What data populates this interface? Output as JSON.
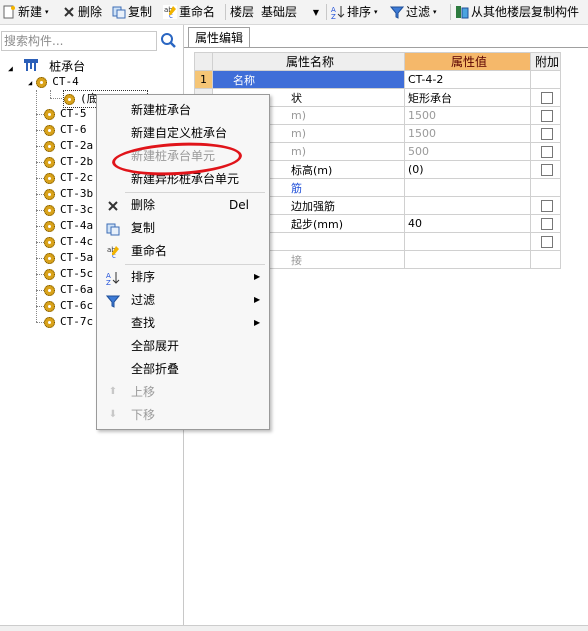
{
  "toolbar": {
    "new_label": "新建",
    "delete_label": "删除",
    "copy_label": "复制",
    "rename_label": "重命名",
    "floor_label": "楼层",
    "floor_value": "基础层",
    "sort_label": "排序",
    "filter_label": "过滤",
    "copy_from_label": "从其他楼层复制构件"
  },
  "search": {
    "placeholder": "搜索构件..."
  },
  "tree": {
    "root": "桩承台",
    "items": [
      "CT-4",
      "(底)CT-4-2",
      "CT-5",
      "CT-6",
      "CT-2a",
      "CT-2b",
      "CT-2c",
      "CT-3b",
      "CT-3c",
      "CT-4a",
      "CT-4c",
      "CT-5a",
      "CT-5c",
      "CT-6a",
      "CT-6c",
      "CT-7c"
    ]
  },
  "props": {
    "tab": "属性编辑",
    "col_name": "属性名称",
    "col_value": "属性值",
    "col_extra": "附加",
    "rows": [
      {
        "num": "1",
        "name": "名称",
        "value": "CT-4-2"
      },
      {
        "num": "",
        "name": "状",
        "value": "矩形承台"
      },
      {
        "num": "",
        "name": "m)",
        "value": "1500"
      },
      {
        "num": "",
        "name": "m)",
        "value": "1500"
      },
      {
        "num": "",
        "name": "m)",
        "value": "500"
      },
      {
        "num": "",
        "name": "标高(m)",
        "value": "(0)"
      },
      {
        "num": "",
        "name": "筋",
        "value": ""
      },
      {
        "num": "",
        "name": "边加强筋",
        "value": ""
      },
      {
        "num": "",
        "name": "起步(mm)",
        "value": "40"
      },
      {
        "num": "",
        "name": "",
        "value": ""
      },
      {
        "num": "",
        "name": "接",
        "value": ""
      }
    ]
  },
  "menu": {
    "new_cap": "新建桩承台",
    "new_custom_cap": "新建自定义桩承台",
    "new_cap_unit": "新建桩承台单元",
    "new_irregular_unit": "新建异形桩承台单元",
    "delete": "删除",
    "delete_key": "Del",
    "copy": "复制",
    "rename": "重命名",
    "sort": "排序",
    "filter": "过滤",
    "find": "查找",
    "expand_all": "全部展开",
    "collapse_all": "全部折叠",
    "move_up": "上移",
    "move_down": "下移"
  },
  "colors": {
    "highlight_circle": "#e0141a",
    "selection": "#3f6ed8",
    "value_header": "#f5b86a"
  }
}
